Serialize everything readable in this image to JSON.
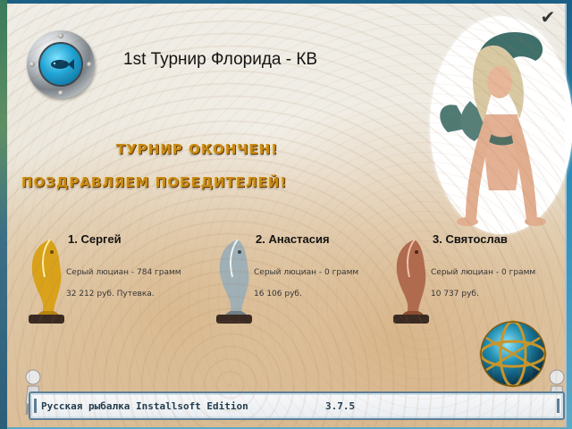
{
  "title": "1st Турнир Флорида - КВ",
  "banner": {
    "line1": "ТУРНИР ОКОНЧЕН!",
    "line2": "ПОЗДРАВЛЯЕМ ПОБЕДИТЕЛЕЙ!"
  },
  "winners": [
    {
      "name": "1. Сергей",
      "catch": "Серый люциан - 784 грамм",
      "prize": "32 212 руб. Путевка.",
      "trophy": "gold-fish-trophy",
      "color": "#d9a21a"
    },
    {
      "name": "2. Анастасия",
      "catch": "Серый люциан - 0 грамм",
      "prize": "16 106 руб.",
      "trophy": "silver-fish-trophy",
      "color": "#9fb0b6"
    },
    {
      "name": "3. Святослав",
      "catch": "Серый люциан - 0 грамм",
      "prize": "10 737 руб.",
      "trophy": "bronze-fish-trophy",
      "color": "#b06b4f"
    }
  ],
  "status_bar": {
    "text": "Русская рыбалка Installsoft Edition",
    "version": "3.7.5"
  },
  "icons": {
    "close": "checkmark-icon",
    "porthole": "porthole-fish-icon",
    "globe": "net-globe-icon",
    "mascot": "mermaid-image"
  },
  "colors": {
    "banner_gold": "#c98b17",
    "frame_blue": "#5c7f97"
  }
}
